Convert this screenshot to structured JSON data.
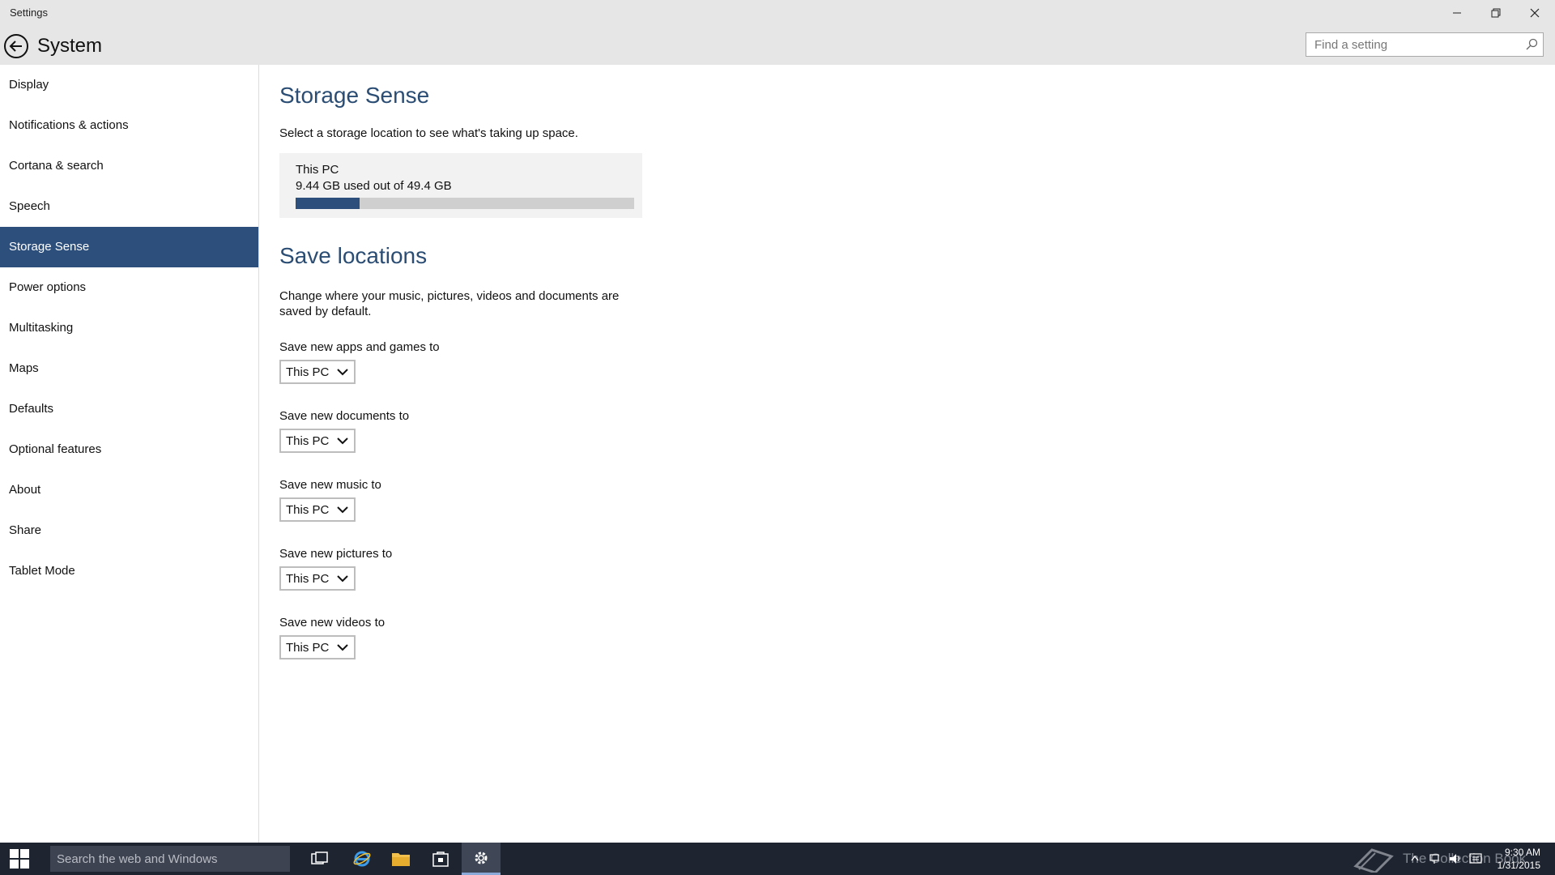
{
  "window": {
    "title": "Settings"
  },
  "header": {
    "title": "System"
  },
  "search": {
    "placeholder": "Find a setting"
  },
  "sidebar": {
    "items": [
      {
        "label": "Display"
      },
      {
        "label": "Notifications & actions"
      },
      {
        "label": "Cortana & search"
      },
      {
        "label": "Speech"
      },
      {
        "label": "Storage Sense",
        "active": true
      },
      {
        "label": "Power options"
      },
      {
        "label": "Multitasking"
      },
      {
        "label": "Maps"
      },
      {
        "label": "Defaults"
      },
      {
        "label": "Optional features"
      },
      {
        "label": "About"
      },
      {
        "label": "Share"
      },
      {
        "label": "Tablet Mode"
      }
    ]
  },
  "main": {
    "title": "Storage Sense",
    "subtitle": "Select a storage location to see what's taking up space.",
    "storage": {
      "name": "This PC",
      "usage_text": "9.44 GB used out of 49.4 GB",
      "used_fraction": 0.19
    },
    "save_locations": {
      "title": "Save locations",
      "description": "Change where your music, pictures, videos and documents are saved by default.",
      "settings": [
        {
          "label": "Save new apps and games to",
          "value": "This PC"
        },
        {
          "label": "Save new documents to",
          "value": "This PC"
        },
        {
          "label": "Save new music to",
          "value": "This PC"
        },
        {
          "label": "Save new pictures to",
          "value": "This PC"
        },
        {
          "label": "Save new videos to",
          "value": "This PC"
        }
      ]
    }
  },
  "taskbar": {
    "search_placeholder": "Search the web and Windows",
    "watermark": "The Collection Book",
    "time": "9:30 AM",
    "date": "1/31/2015"
  },
  "colors": {
    "accent": "#2d4f7c",
    "title_accent": "#2b4d74",
    "taskbar": "#1e2430"
  }
}
